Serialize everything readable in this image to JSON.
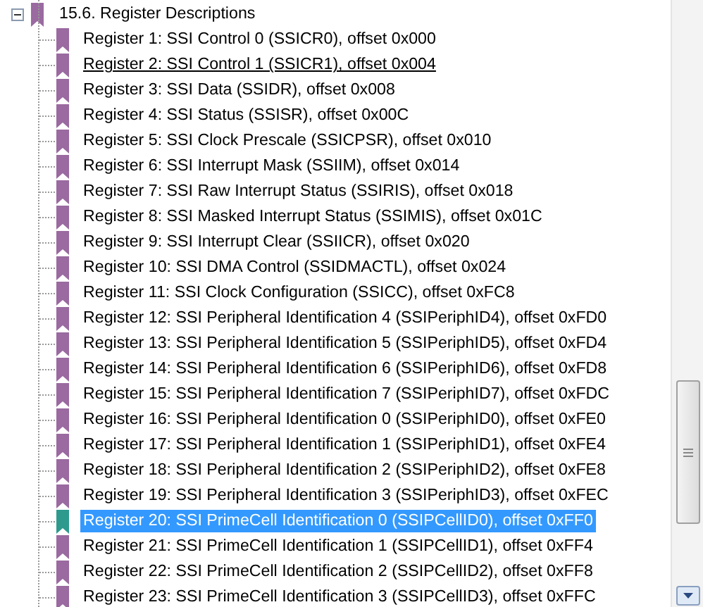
{
  "outline": {
    "title": "15.6. Register Descriptions",
    "expanded": true,
    "children": [
      {
        "label": "Register 1: SSI Control 0 (SSICR0), offset 0x000",
        "selected": false,
        "hovered": false
      },
      {
        "label": "Register 2: SSI Control 1 (SSICR1), offset 0x004",
        "selected": false,
        "hovered": true
      },
      {
        "label": "Register 3: SSI Data (SSIDR), offset 0x008",
        "selected": false,
        "hovered": false
      },
      {
        "label": "Register 4: SSI Status (SSISR), offset 0x00C",
        "selected": false,
        "hovered": false
      },
      {
        "label": "Register 5: SSI Clock Prescale (SSICPSR), offset 0x010",
        "selected": false,
        "hovered": false
      },
      {
        "label": "Register 6: SSI Interrupt Mask (SSIIM), offset 0x014",
        "selected": false,
        "hovered": false
      },
      {
        "label": "Register 7: SSI Raw Interrupt Status (SSIRIS), offset 0x018",
        "selected": false,
        "hovered": false
      },
      {
        "label": "Register 8: SSI Masked Interrupt Status (SSIMIS), offset 0x01C",
        "selected": false,
        "hovered": false
      },
      {
        "label": "Register 9: SSI Interrupt Clear (SSIICR), offset 0x020",
        "selected": false,
        "hovered": false
      },
      {
        "label": "Register 10: SSI DMA Control (SSIDMACTL), offset 0x024",
        "selected": false,
        "hovered": false
      },
      {
        "label": "Register 11: SSI Clock Configuration (SSICC), offset 0xFC8",
        "selected": false,
        "hovered": false
      },
      {
        "label": "Register 12: SSI Peripheral Identification 4 (SSIPeriphID4), offset 0xFD0",
        "selected": false,
        "hovered": false
      },
      {
        "label": "Register 13: SSI Peripheral Identification 5 (SSIPeriphID5), offset 0xFD4",
        "selected": false,
        "hovered": false
      },
      {
        "label": "Register 14: SSI Peripheral Identification 6 (SSIPeriphID6), offset 0xFD8",
        "selected": false,
        "hovered": false
      },
      {
        "label": "Register 15: SSI Peripheral Identification 7 (SSIPeriphID7), offset 0xFDC",
        "selected": false,
        "hovered": false
      },
      {
        "label": "Register 16: SSI Peripheral Identification 0 (SSIPeriphID0), offset 0xFE0",
        "selected": false,
        "hovered": false
      },
      {
        "label": "Register 17: SSI Peripheral Identification 1 (SSIPeriphID1), offset 0xFE4",
        "selected": false,
        "hovered": false
      },
      {
        "label": "Register 18: SSI Peripheral Identification 2 (SSIPeriphID2), offset 0xFE8",
        "selected": false,
        "hovered": false
      },
      {
        "label": "Register 19: SSI Peripheral Identification 3 (SSIPeriphID3), offset 0xFEC",
        "selected": false,
        "hovered": false
      },
      {
        "label": "Register 20: SSI PrimeCell Identification 0 (SSIPCellID0), offset 0xFF0",
        "selected": true,
        "hovered": false
      },
      {
        "label": "Register 21: SSI PrimeCell Identification 1 (SSIPCellID1), offset 0xFF4",
        "selected": false,
        "hovered": false
      },
      {
        "label": "Register 22: SSI PrimeCell Identification 2 (SSIPCellID2), offset 0xFF8",
        "selected": false,
        "hovered": false
      },
      {
        "label": "Register 23: SSI PrimeCell Identification 3 (SSIPCellID3), offset 0xFFC",
        "selected": false,
        "hovered": false
      }
    ]
  }
}
